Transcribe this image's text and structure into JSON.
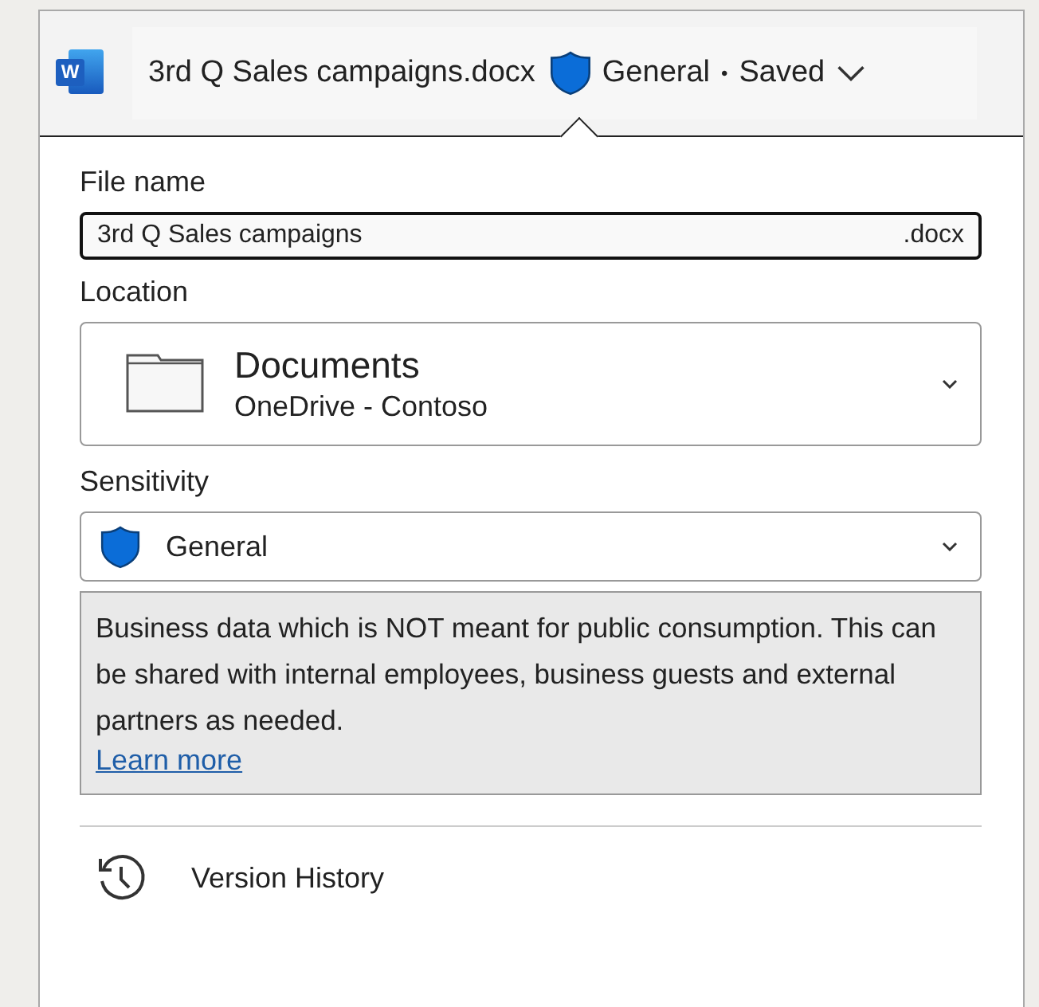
{
  "title_bar": {
    "app_letter": "W",
    "file_name": "3rd Q Sales campaigns.docx",
    "label": "General",
    "separator": "•",
    "status": "Saved"
  },
  "file_name": {
    "label": "File name",
    "value": "3rd Q Sales campaigns",
    "extension": ".docx"
  },
  "location": {
    "label": "Location",
    "folder": "Documents",
    "path": "OneDrive - Contoso"
  },
  "sensitivity": {
    "label": "Sensitivity",
    "value": "General",
    "description": "Business data which is NOT meant for public consumption. This can be shared with internal employees, business guests and external partners as needed.",
    "link": "Learn more"
  },
  "actions": [
    {
      "label": "Version History"
    }
  ]
}
